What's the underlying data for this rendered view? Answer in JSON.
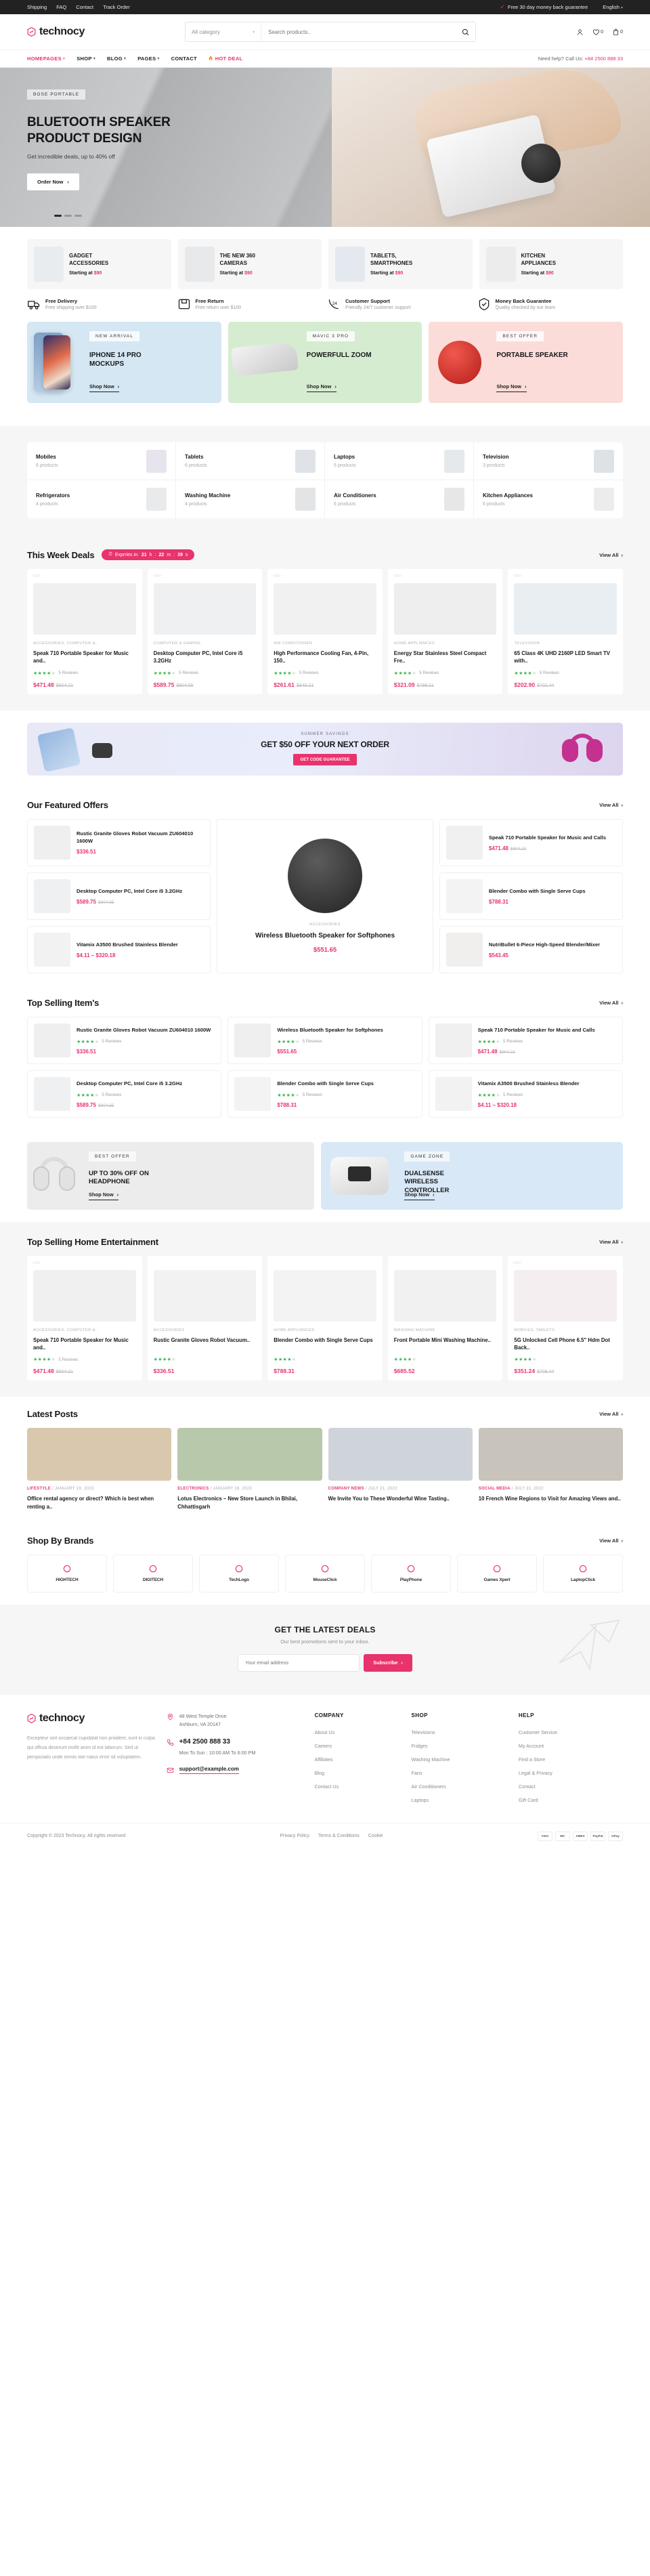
{
  "topbar": {
    "links": [
      "Shipping",
      "FAQ",
      "Contact",
      "Track Order"
    ],
    "guarantee": "Free 30 day money back guarantee",
    "language": "English"
  },
  "header": {
    "brand": "technocy",
    "category_select": "All category",
    "search_placeholder": "Search products..",
    "wishlist_count": "0",
    "cart_count": "0"
  },
  "nav": {
    "items": [
      {
        "label": "HOMEPAGES",
        "caret": true,
        "style": "active"
      },
      {
        "label": "SHOP",
        "caret": true,
        "style": ""
      },
      {
        "label": "BLOG",
        "caret": true,
        "style": ""
      },
      {
        "label": "PAGES",
        "caret": true,
        "style": ""
      },
      {
        "label": "CONTACT",
        "caret": false,
        "style": ""
      },
      {
        "label": "HOT DEAL",
        "caret": false,
        "style": "hot"
      }
    ],
    "help_prefix": "Need help? Call Us: ",
    "help_phone": "+84 2500 888 33"
  },
  "hero": {
    "tag": "BOSE PORTABLE",
    "title_line1": "BLUETOOTH SPEAKER",
    "title_line2": "PRODUCT DESIGN",
    "subtitle": "Get incredible deals, up to 40% off",
    "button": "Order Now"
  },
  "cat_cards": [
    {
      "title_l1": "GADGET",
      "title_l2": "ACCESSORIES",
      "price_label": "Starting at ",
      "price": "$90",
      "color": "#e9ecef"
    },
    {
      "title_l1": "THE NEW 360",
      "title_l2": "CAMERAS",
      "price_label": "Starting at ",
      "price": "$90",
      "color": "#e7e9ea"
    },
    {
      "title_l1": "TABLETS,",
      "title_l2": "SMARTPHONES",
      "price_label": "Starting at ",
      "price": "$90",
      "color": "#e4e9ef"
    },
    {
      "title_l1": "KITCHEN",
      "title_l2": "APPLIANCES",
      "price_label": "Starting at ",
      "price": "$90",
      "color": "#ececec"
    }
  ],
  "features": [
    {
      "icon": "truck-icon",
      "title": "Free Delivery",
      "desc": "Free shipping over $100"
    },
    {
      "icon": "return-icon",
      "title": "Free Return",
      "desc": "Free return over $100"
    },
    {
      "icon": "support-icon",
      "title": "Customer Support",
      "desc": "Friendly 24/7 customer support"
    },
    {
      "icon": "shield-icon",
      "title": "Money Back Guarantee",
      "desc": "Quality checked by our team"
    }
  ],
  "promos": [
    {
      "tag": "NEW ARRIVAL",
      "title": "IPHONE 14 PRO MOCKUPS",
      "cta": "Shop Now"
    },
    {
      "tag": "MAVIC 3 PRO",
      "title": "POWERFULL ZOOM",
      "cta": "Shop Now"
    },
    {
      "tag": "BEST OFFER",
      "title": "PORTABLE SPEAKER",
      "cta": "Shop Now"
    }
  ],
  "category_grid": [
    {
      "name": "Mobiles",
      "count": "6 products"
    },
    {
      "name": "Tablets",
      "count": "6 products"
    },
    {
      "name": "Laptops",
      "count": "5 products"
    },
    {
      "name": "Television",
      "count": "3 products"
    },
    {
      "name": "Refrigerators",
      "count": "4 products"
    },
    {
      "name": "Washing Machine",
      "count": "4 products"
    },
    {
      "name": "Air Conditioners",
      "count": "6 products"
    },
    {
      "name": "Kitchen Appliances",
      "count": "6 products"
    }
  ],
  "deals": {
    "title": "This Week Deals",
    "timer_label": "Exprries in:",
    "timer_h": "21",
    "timer_h_u": "h",
    "timer_m": "22",
    "timer_m_u": "m",
    "timer_s": "39",
    "timer_s_u": "s",
    "view_all": "View All",
    "products": [
      {
        "badge": "Sale",
        "cat": "ACCESSORIES, COMPUTER &..",
        "name": "Speak 710 Portable Speaker for Music and..",
        "stars": 4,
        "reviews": "5 Reviews",
        "price": "$471.48",
        "old": "$904.21",
        "img": "#f0f0f0"
      },
      {
        "badge": "Sale",
        "cat": "COMPUTER & GAMING",
        "name": "Desktop Computer PC, Intel Core i5 3.2GHz",
        "stars": 4,
        "reviews": "5 Reviews",
        "price": "$589.75",
        "old": "$904.55",
        "img": "#eef0f2"
      },
      {
        "badge": "Sale",
        "cat": "AIR CONDITIONER",
        "name": "High Performance Cooling Fan, 4-Pin, 150..",
        "stars": 4,
        "reviews": "5 Reviews",
        "price": "$261.61",
        "old": "$845.21",
        "img": "#f1f1f1"
      },
      {
        "badge": "Sale",
        "cat": "HOME APPLIANCES",
        "name": "Energy Star Stainless Steel Compact Fre..",
        "stars": 4,
        "reviews": "5 Reviews",
        "price": "$321.09",
        "old": "$798.21",
        "img": "#eeeeee"
      },
      {
        "badge": "Sale",
        "cat": "TELEVISION",
        "name": "65 Class 4K UHD 2160P LED Smart TV with..",
        "stars": 4,
        "reviews": "5 Reviews",
        "price": "$202.90",
        "old": "$701.44",
        "img": "#e9eef3"
      }
    ]
  },
  "wide_banner": {
    "tag": "SUMMER SAVINGS",
    "headline": "GET $50 OFF YOUR NEXT ORDER",
    "button": "GET CODE GUARANTEE"
  },
  "featured": {
    "title": "Our Featured Offers",
    "view_all": "View All",
    "left": [
      {
        "name": "Rustic Granite Gloves Robot Vacuum ZU604010 1600W",
        "price": "$336.51",
        "old": "",
        "img": "#efefef"
      },
      {
        "name": "Desktop Computer PC, Intel Core i5 3.2GHz",
        "price": "$589.75",
        "old": "$904.55",
        "img": "#eef0f2"
      },
      {
        "name": "Vitamix A3500 Brushed Stainless Blender",
        "price": "$4.11 – $320.18",
        "old": "",
        "img": "#f2f2f2"
      }
    ],
    "center": {
      "cat": "ACCESSORIES",
      "name": "Wireless Bluetooth Speaker for Softphones",
      "price": "$551.65"
    },
    "right": [
      {
        "name": "Speak 710 Portable Speaker for Music and Calls",
        "price": "$471.48",
        "old": "$904.21",
        "img": "#f0f0f0"
      },
      {
        "name": "Blender Combo with Single Serve Cups",
        "price": "$788.31",
        "old": "",
        "img": "#f3f3f3"
      },
      {
        "name": "NutriBullet 6-Piece High-Speed Blender/Mixer",
        "price": "$543.45",
        "old": "",
        "img": "#f1eeee"
      }
    ]
  },
  "topselling": {
    "title": "Top Selling Item's",
    "view_all": "View All",
    "items": [
      {
        "name": "Rustic Granite Gloves Robot Vacuum ZU604010 1600W",
        "stars": 4,
        "reviews": "5 Reviews",
        "price": "$336.51",
        "old": "",
        "img": "#efefef"
      },
      {
        "name": "Wireless Bluetooth Speaker for Softphones",
        "stars": 4,
        "reviews": "5 Reviews",
        "price": "$551.65",
        "old": "",
        "img": "#efefef"
      },
      {
        "name": "Speak 710 Portable Speaker for Music and Calls",
        "stars": 4,
        "reviews": "5 Reviews",
        "price": "$471.48",
        "old": "$904.21",
        "img": "#f0f0f0"
      },
      {
        "name": "Desktop Computer PC, Intel Core i5 3.2GHz",
        "stars": 4,
        "reviews": "5 Reviews",
        "price": "$589.75",
        "old": "$904.55",
        "img": "#eef0f2"
      },
      {
        "name": "Blender Combo with Single Serve Cups",
        "stars": 4,
        "reviews": "5 Reviews",
        "price": "$788.31",
        "old": "",
        "img": "#f3f3f3"
      },
      {
        "name": "Vitamix A3500 Brushed Stainless Blender",
        "stars": 4,
        "reviews": "5 Reviews",
        "price": "$4.11 – $320.18",
        "old": "",
        "img": "#f2f2f2"
      }
    ]
  },
  "banners2": [
    {
      "tag": "BEST OFFER",
      "title": "UP TO 30% OFF ON HEADPHONE",
      "cta": "Shop Now"
    },
    {
      "tag": "GAME ZONE",
      "title": "DUALSENSE WIRELESS CONTROLLER",
      "cta": "Shop Now"
    }
  ],
  "home_ent": {
    "title": "Top Selling Home Entertainment",
    "view_all": "View All",
    "items": [
      {
        "badge": "Sale",
        "cat": "ACCESSORIES, COMPUTER &..",
        "name": "Speak 710 Portable Speaker for Music and..",
        "stars": 4,
        "reviews": "5 Reviews",
        "price": "$471.48",
        "old": "$904.21",
        "img": "#f0f0f0"
      },
      {
        "badge": "",
        "cat": "ACCESSORIES",
        "name": "Rustic Granite Gloves Robot Vacuum..",
        "stars": 4,
        "reviews": "",
        "price": "$336.51",
        "old": "",
        "img": "#f2f2f2"
      },
      {
        "badge": "",
        "cat": "HOME APPLIANCES",
        "name": "Blender Combo with Single Serve Cups",
        "stars": 4,
        "reviews": "",
        "price": "$788.31",
        "old": "",
        "img": "#f3f3f3"
      },
      {
        "badge": "",
        "cat": "WASHING MACHINE",
        "name": "Front Portable Mini Washing Machine..",
        "stars": 4,
        "reviews": "",
        "price": "$685.52",
        "old": "",
        "img": "#f1f1f1"
      },
      {
        "badge": "Sale",
        "cat": "MOBILES, TABLETS",
        "name": "5G Unlocked Cell Phone 6.5\" Hdm Dot Back..",
        "stars": 4,
        "reviews": "",
        "price": "$351.24",
        "old": "$709.44",
        "img": "#f4eef0"
      }
    ]
  },
  "blog": {
    "title": "Latest Posts",
    "view_all": "View All",
    "posts": [
      {
        "cat": "LIFESTYLE",
        "date": "JANUARY 19, 2023",
        "title": "Office rental agency or direct? Which is best when renting a..",
        "img": "#d9c7ae"
      },
      {
        "cat": "ELECTRONICS",
        "date": "JANUARY 18, 2023",
        "title": "Lotus Electronics – New Store Launch in Bhilai, Chhattisgarh",
        "img": "#b8c9ab"
      },
      {
        "cat": "COMPANY NEWS",
        "date": "JULY 21, 2022",
        "title": "We Invite You to These Wonderful Wine Tasting..",
        "img": "#cfd4da"
      },
      {
        "cat": "SOCIAL MEDIA",
        "date": "JULY 21, 2022",
        "title": "10 French Wine Regions to Visit for Amazing Views and..",
        "img": "#c8c3bb"
      }
    ]
  },
  "brands": {
    "title": "Shop By Brands",
    "view_all": "View All",
    "items": [
      {
        "name": "HIGHTECH"
      },
      {
        "name": "DIGITECH"
      },
      {
        "name": "TechLogo"
      },
      {
        "name": "MouseClick"
      },
      {
        "name": "PlayPhone"
      },
      {
        "name": "Games Xpert"
      },
      {
        "name": "LaptopClick"
      }
    ]
  },
  "newsletter": {
    "title": "GET THE LATEST DEALS",
    "subtitle": "Our best promotions sent to your inbox.",
    "placeholder": "Your email address",
    "button": "Subscribe"
  },
  "footer": {
    "brand": "technocy",
    "about": "Excepteur sint occaecat cupidatat non proident, sunt in culpa qui officia deserunt mollit anim id est laborum. Sed ut perspiciatis unde omnis iste natus error sit voluptatem.",
    "about_link": "anim id est laborum",
    "address_l1": "48 West Temple Drive",
    "address_l2": "Ashburn, VA 20147",
    "phone": "+84 2500 888 33",
    "hours": "Mon To Sun : 10:00 AM To 6:00 PM",
    "email": "support@example.com",
    "columns": [
      {
        "heading": "COMPANY",
        "links": [
          "About Us",
          "Careers",
          "Affiliates",
          "Blog",
          "Contact Us"
        ]
      },
      {
        "heading": "SHOP",
        "links": [
          "Televisions",
          "Fridges",
          "Washing Machine",
          "Fans",
          "Air Conditioners",
          "Laptops"
        ]
      },
      {
        "heading": "HELP",
        "links": [
          "Customer Service",
          "My Account",
          "Find a Store",
          "Legal & Privacy",
          "Contact",
          "Gift Card"
        ]
      }
    ],
    "copyright": "Copyright © 2023 Technocy. All rights reserved",
    "bottom_links": [
      "Privacy Policy",
      "Terms & Conditions",
      "Cookie"
    ],
    "payments": [
      "VISA",
      "MC",
      "AMEX",
      "PayPal",
      "GPay"
    ]
  },
  "colors": {
    "accent": "#e8336d",
    "dark": "#222222",
    "star": "#3ab54a"
  }
}
